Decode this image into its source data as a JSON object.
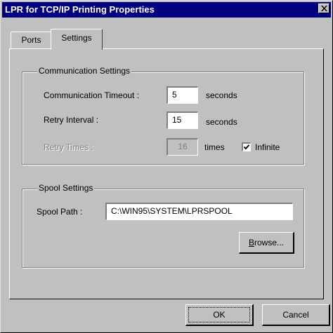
{
  "window": {
    "title": "LPR for TCP/IP Printing Properties"
  },
  "tabs": {
    "ports": "Ports",
    "settings": "Settings"
  },
  "communication": {
    "group_title": "Communication Settings",
    "timeout_label": "Communication Timeout :",
    "timeout_value": "5",
    "timeout_unit": "seconds",
    "retry_interval_label": "Retry Interval :",
    "retry_interval_value": "15",
    "retry_interval_unit": "seconds",
    "retry_times_label": "Retry Times :",
    "retry_times_value": "16",
    "retry_times_unit": "times",
    "infinite_label": "Infinite",
    "infinite_checked": true
  },
  "spool": {
    "group_title": "Spool Settings",
    "path_label": "Spool Path :",
    "path_value": "C:\\WIN95\\SYSTEM\\LPRSPOOL",
    "browse_rest": "rowse...",
    "browse_accel": "B"
  },
  "buttons": {
    "ok": "OK",
    "cancel": "Cancel"
  },
  "icons": {
    "close": "close-icon",
    "checkmark": "checkmark-icon"
  },
  "colors": {
    "titlebar": "#000080",
    "face": "#c0c0c0"
  }
}
